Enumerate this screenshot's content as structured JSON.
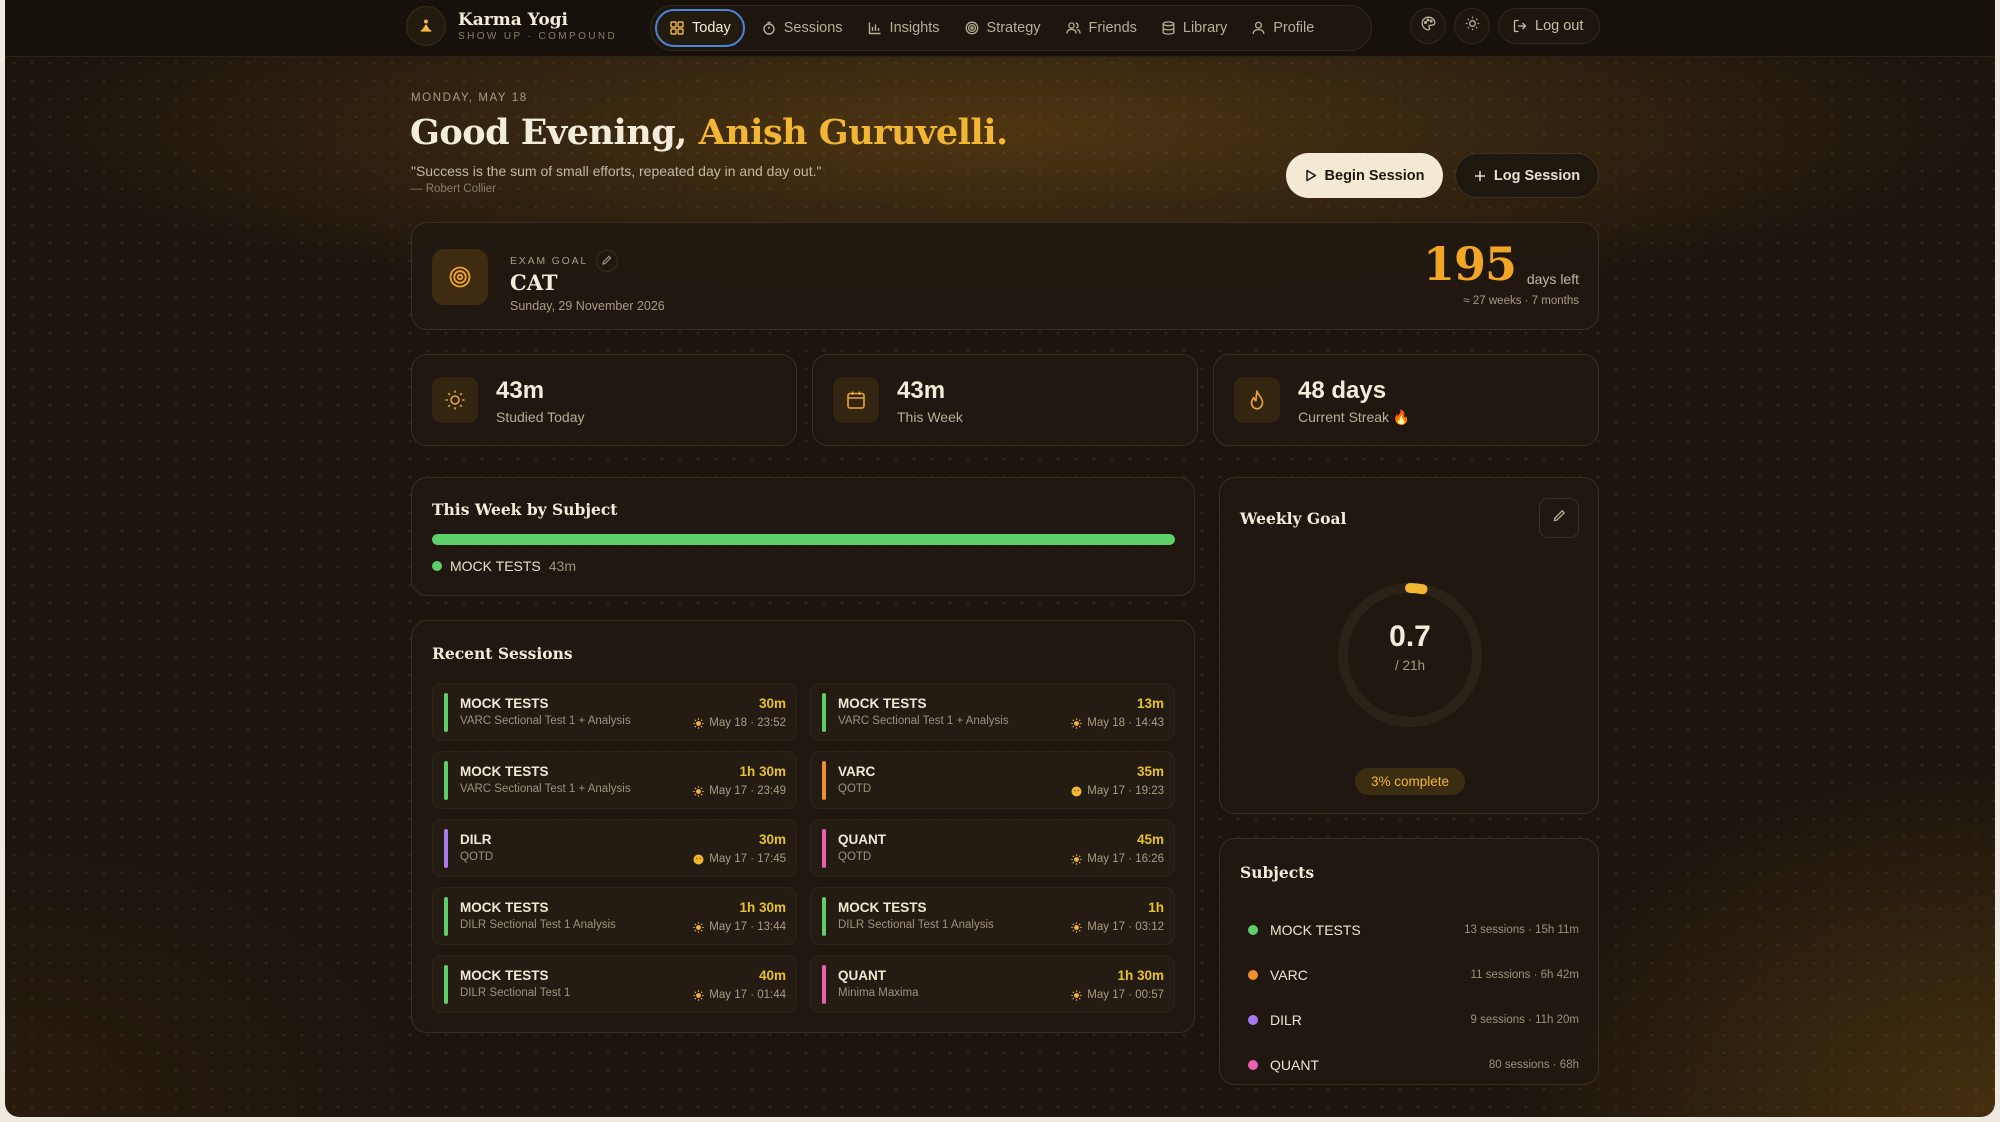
{
  "app": {
    "name": "Karma Yogi",
    "tagline": "SHOW UP · COMPOUND"
  },
  "nav": {
    "items": [
      {
        "label": "Today",
        "icon": "grid-icon",
        "active": true
      },
      {
        "label": "Sessions",
        "icon": "timer-icon"
      },
      {
        "label": "Insights",
        "icon": "bar-chart-icon"
      },
      {
        "label": "Strategy",
        "icon": "target-icon"
      },
      {
        "label": "Friends",
        "icon": "users-icon"
      },
      {
        "label": "Library",
        "icon": "database-icon"
      },
      {
        "label": "Profile",
        "icon": "user-icon"
      }
    ],
    "logout_label": "Log out"
  },
  "header": {
    "date": "MONDAY, MAY 18",
    "greeting": "Good Evening, ",
    "name": "Anish Guruvelli.",
    "quote": "\"Success is the sum of small efforts, repeated day in and day out.\"",
    "quote_author": "— Robert Collier",
    "begin_label": "Begin Session",
    "log_label": "Log Session"
  },
  "exam": {
    "label": "EXAM GOAL",
    "name": "CAT",
    "date": "Sunday, 29 November 2026",
    "days_left": "195",
    "days_label": "days left",
    "days_sub": "≈ 27 weeks · 7 months"
  },
  "stats": [
    {
      "value": "43m",
      "label": "Studied Today",
      "icon": "sun-icon"
    },
    {
      "value": "43m",
      "label": "This Week",
      "icon": "calendar-icon"
    },
    {
      "value": "48 days",
      "label": "Current Streak 🔥",
      "icon": "flame-icon"
    }
  ],
  "week_by_subject": {
    "title": "This Week by Subject",
    "segments": [
      {
        "subject": "MOCK TESTS",
        "value": "43m",
        "share": 1.0,
        "color": "#5fd068"
      }
    ]
  },
  "recent": {
    "title": "Recent Sessions",
    "sessions": [
      {
        "subject": "MOCK TESTS",
        "note": "VARC Sectional Test 1 + Analysis",
        "duration": "30m",
        "time": "May 18 · 23:52",
        "color": "#5fd068",
        "tod": "sun"
      },
      {
        "subject": "MOCK TESTS",
        "note": "VARC Sectional Test 1 + Analysis",
        "duration": "13m",
        "time": "May 18 · 14:43",
        "color": "#5fd068",
        "tod": "sun"
      },
      {
        "subject": "MOCK TESTS",
        "note": "VARC Sectional Test 1 + Analysis",
        "duration": "1h 30m",
        "time": "May 17 · 23:49",
        "color": "#5fd068",
        "tod": "sun"
      },
      {
        "subject": "VARC",
        "note": "QOTD",
        "duration": "35m",
        "time": "May 17 · 19:23",
        "color": "#f0902d",
        "tod": "face"
      },
      {
        "subject": "DILR",
        "note": "QOTD",
        "duration": "30m",
        "time": "May 17 · 17:45",
        "color": "#a979f0",
        "tod": "face"
      },
      {
        "subject": "QUANT",
        "note": "QOTD",
        "duration": "45m",
        "time": "May 17 · 16:26",
        "color": "#ea5fae",
        "tod": "sun"
      },
      {
        "subject": "MOCK TESTS",
        "note": "DILR Sectional Test 1 Analysis",
        "duration": "1h 30m",
        "time": "May 17 · 13:44",
        "color": "#5fd068",
        "tod": "sun"
      },
      {
        "subject": "MOCK TESTS",
        "note": "DILR Sectional Test 1 Analysis",
        "duration": "1h",
        "time": "May 17 · 03:12",
        "color": "#5fd068",
        "tod": "sun"
      },
      {
        "subject": "MOCK TESTS",
        "note": "DILR Sectional Test 1",
        "duration": "40m",
        "time": "May 17 · 01:44",
        "color": "#5fd068",
        "tod": "sun"
      },
      {
        "subject": "QUANT",
        "note": "Minima Maxima",
        "duration": "1h 30m",
        "time": "May 17 · 00:57",
        "color": "#ea5fae",
        "tod": "sun"
      }
    ]
  },
  "weekly_goal": {
    "title": "Weekly Goal",
    "value": "0.7",
    "target": "/ 21h",
    "progress": 0.03,
    "complete_label": "3% complete"
  },
  "subjects": {
    "title": "Subjects",
    "items": [
      {
        "name": "MOCK TESTS",
        "meta": "13 sessions · 15h 11m",
        "color": "#5fd068"
      },
      {
        "name": "VARC",
        "meta": "11 sessions · 6h 42m",
        "color": "#f0902d"
      },
      {
        "name": "DILR",
        "meta": "9 sessions · 11h 20m",
        "color": "#a979f0"
      },
      {
        "name": "QUANT",
        "meta": "80 sessions · 68h",
        "color": "#ea5fae"
      }
    ]
  },
  "colors": {
    "accent": "#f2b632",
    "primary_text": "#f4ecdb",
    "background": "#1c150e",
    "focus_ring": "#4b86d8"
  }
}
